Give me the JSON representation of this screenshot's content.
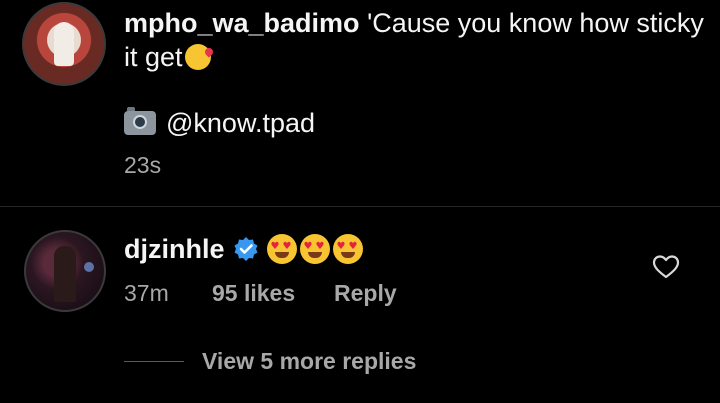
{
  "post": {
    "username": "mpho_wa_badimo",
    "caption": "'Cause you know how sticky it get",
    "caption_emoji": "kissing-heart-emoji",
    "credit_icon": "camera-icon",
    "credit_handle": "@know.tpad",
    "time": "23s"
  },
  "comment": {
    "username": "djzinhle",
    "verified_icon": "verified-badge-icon",
    "emoji_text": "heart-eyes-emoji x3",
    "time": "37m",
    "likes": "95 likes",
    "reply_label": "Reply",
    "like_icon": "heart-outline-icon",
    "view_replies_label": "View 5 more replies"
  },
  "colors": {
    "background": "#000000",
    "text": "#f5f5f5",
    "secondary": "#a8a8a8",
    "verified": "#3897f0"
  }
}
